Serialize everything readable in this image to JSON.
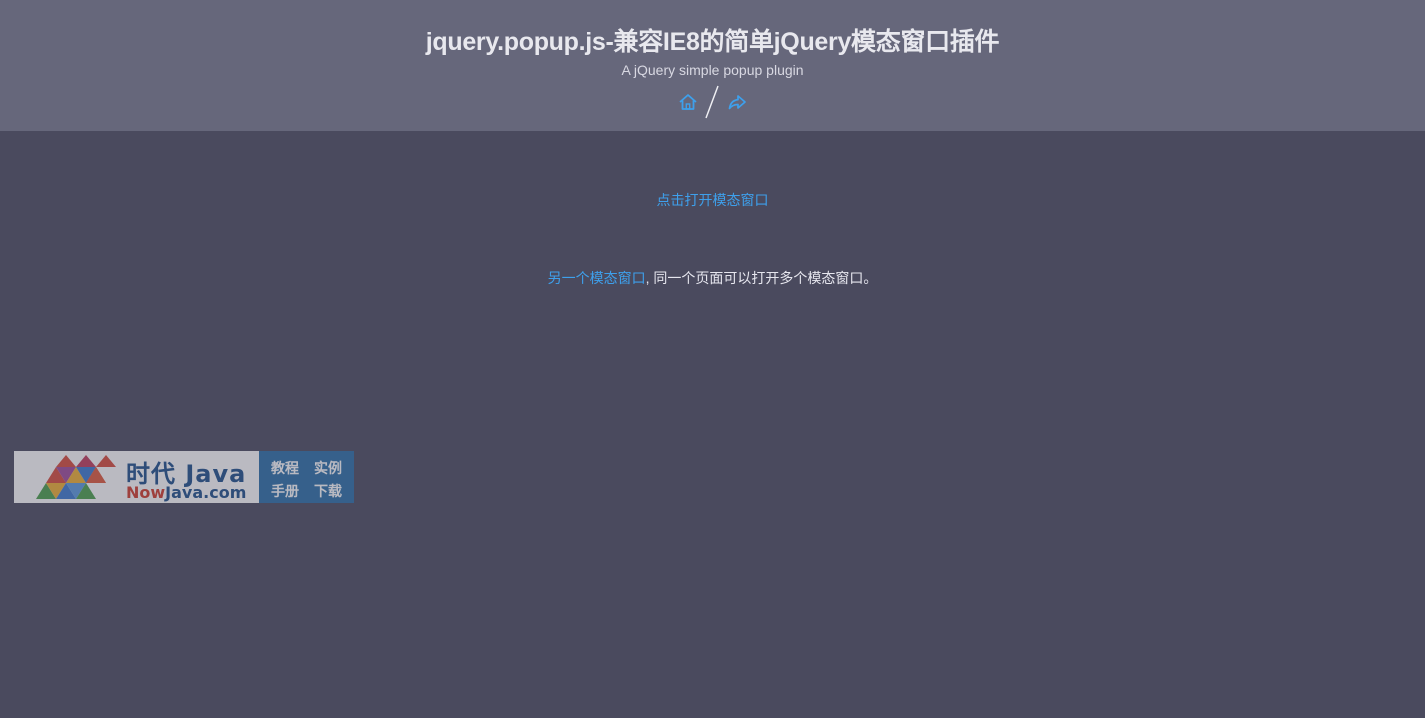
{
  "header": {
    "title": "jquery.popup.js-兼容IE8的简单jQuery模态窗口插件",
    "subtitle": "A jQuery simple popup plugin",
    "home_icon": "home-icon",
    "share_icon": "share-icon"
  },
  "content": {
    "open_modal_link": "点击打开模态窗口",
    "another_modal_link": "另一个模态窗口",
    "another_modal_text": ", 同一个页面可以打开多个模态窗口。"
  },
  "watermark": {
    "brand_cn": "时代 Java",
    "brand_en_prefix": "Now",
    "brand_en_suffix": "Java.com",
    "menu": [
      "教程",
      "实例",
      "手册",
      "下载"
    ]
  },
  "colors": {
    "header_bg": "#66677b",
    "body_bg": "#4a4a5e",
    "link": "#3ea0ec",
    "text": "#e6e6ee"
  }
}
